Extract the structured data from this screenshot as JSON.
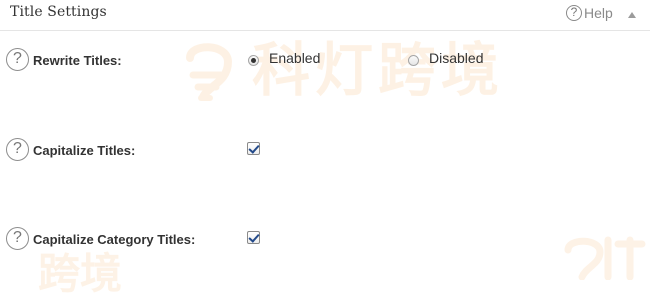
{
  "header": {
    "title": "Title Settings",
    "help_label": "Help"
  },
  "watermark": {
    "text": "科灯跨境",
    "bottom_left_text": "跨境"
  },
  "settings": [
    {
      "label": "Rewrite Titles:",
      "type": "radio",
      "options": [
        {
          "label": "Enabled",
          "selected": true
        },
        {
          "label": "Disabled",
          "selected": false
        }
      ]
    },
    {
      "label": "Capitalize Titles:",
      "type": "checkbox",
      "checked": true
    },
    {
      "label": "Capitalize Category Titles:",
      "type": "checkbox",
      "checked": true
    }
  ],
  "colors": {
    "watermark": "#f08a18",
    "checkmark": "#234a8a",
    "text": "#333333"
  },
  "icons": {
    "help": "question-circle-icon",
    "collapse": "triangle-up-icon"
  }
}
